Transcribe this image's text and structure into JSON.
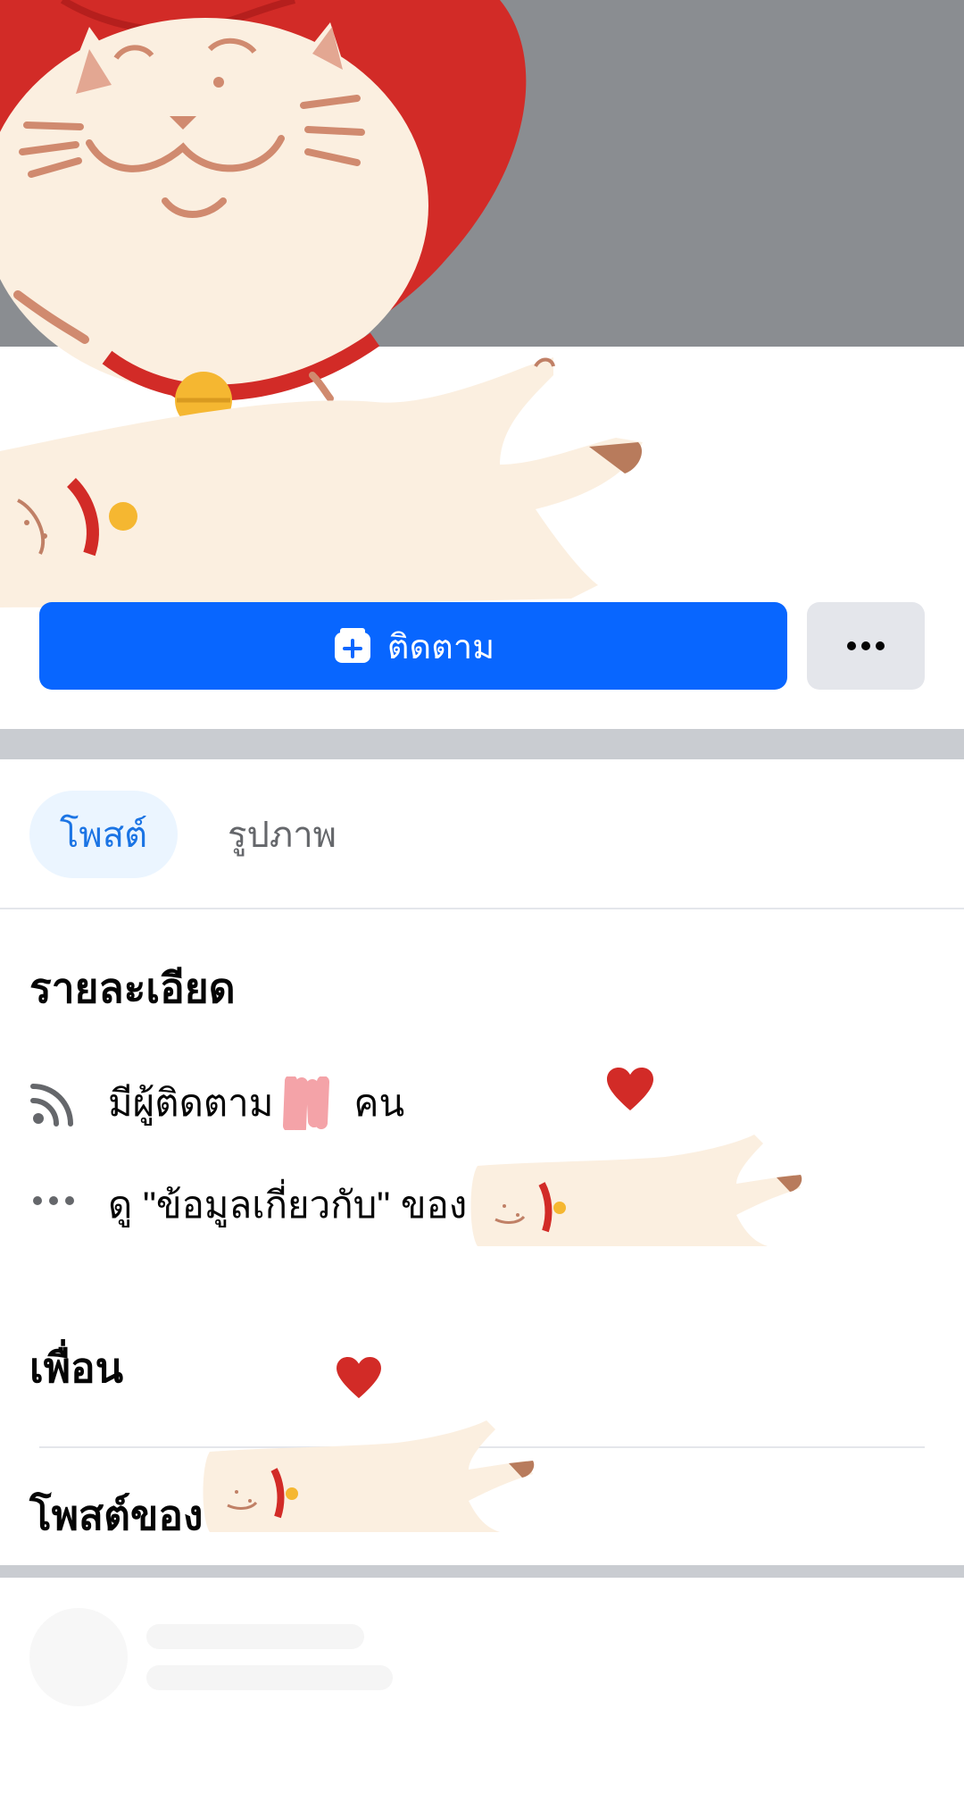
{
  "colors": {
    "brand_blue": "#0866ff",
    "cover_gray": "#8a8d91",
    "tab_active_bg": "#ebf5ff",
    "tab_active_text": "#1b74e4",
    "secondary_button_bg": "#e4e6eb",
    "separator": "#c9ccd1"
  },
  "actions": {
    "follow_label": "ติดตาม",
    "follow_icon": "follow-add-icon",
    "more_icon": "ellipsis-icon"
  },
  "tabs": [
    {
      "label": "โพสต์",
      "active": true
    },
    {
      "label": "รูปภาพ",
      "active": false
    }
  ],
  "details": {
    "title": "รายละเอียด",
    "followers_prefix": "มีผู้ติดตาม",
    "followers_suffix": "คน",
    "followers_icon": "rss-feed-icon",
    "about_text": "ดู \"ข้อมูลเกี่ยวกับ\" ของ",
    "about_icon": "more-dots-icon"
  },
  "sections": {
    "friends_title": "เพื่อน",
    "posts_of_title": "โพสต์ของ"
  }
}
